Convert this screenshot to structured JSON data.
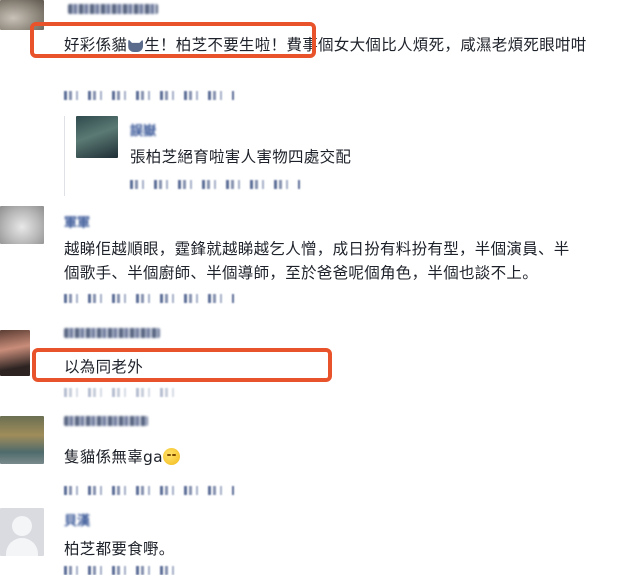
{
  "comments": [
    {
      "text_before_icon": "好彩係貓",
      "icon": "cat-face-emoji",
      "text_after_icon": "生！柏芝不要生啦！費事個女大個比人煩死，咸濕老煩死眼咁咁"
    },
    {
      "reply_name": "誤嶽",
      "text": "張柏芝絕育啦害人害物四處交配"
    },
    {
      "name": "軍軍",
      "text_line1": "越睇佢越順眼，霆鋒就越睇越乞人憎，成日扮有料扮有型，半個演員、半",
      "text_line2": "個歌手、半個廚師、半個導師，至於爸爸呢個角色，半個也談不上。"
    },
    {
      "text": "以為同老外"
    },
    {
      "text": "隻貓係無辜ga",
      "icon": "smiley-emoji"
    },
    {
      "name": "貝漢",
      "text": "柏芝都要食嘢。"
    }
  ],
  "colors": {
    "highlight": "#e8532b",
    "text": "#1d2129",
    "meta": "#4b5f8d"
  }
}
